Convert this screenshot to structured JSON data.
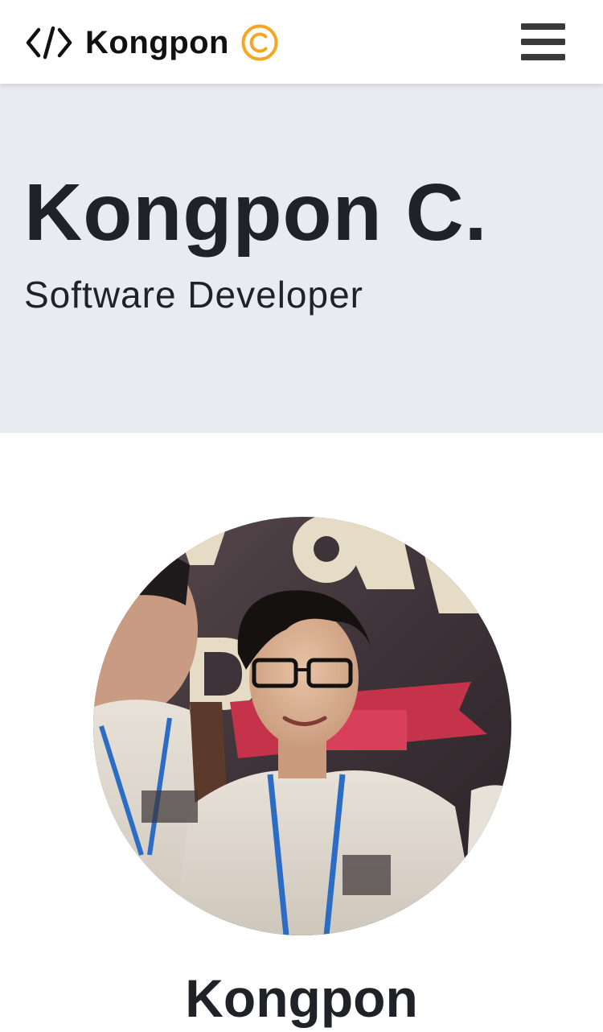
{
  "navbar": {
    "brand_name": "Kongpon",
    "brand_icon": "code-icon",
    "brand_badge_icon": "copyright-icon",
    "menu_icon": "hamburger-menu-icon"
  },
  "hero": {
    "name": "Kongpon C.",
    "role": "Software Developer"
  },
  "profile": {
    "photo_icon": "profile-photo",
    "name": "Kongpon"
  },
  "colors": {
    "hero_background": "#e8ebef",
    "badge_orange": "#f5a623",
    "text_dark": "#1f2328"
  }
}
